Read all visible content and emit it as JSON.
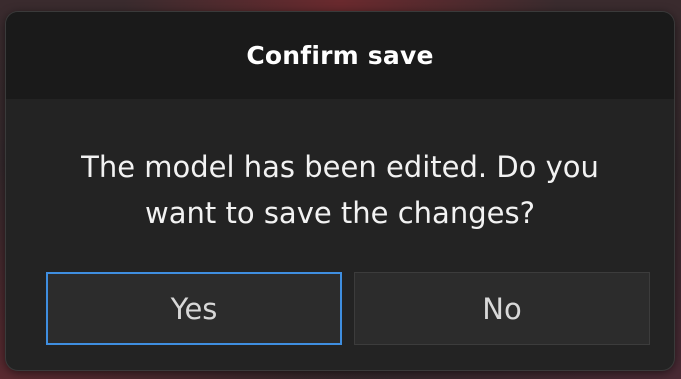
{
  "dialog": {
    "title": "Confirm save",
    "message_line1": "The model has been edited. Do you",
    "message_line2": "want to save the changes?",
    "buttons": {
      "yes_label": "Yes",
      "no_label": "No"
    }
  },
  "colors": {
    "focus_accent": "#3f8ee0",
    "dialog_bg": "#232323",
    "title_bg": "#1a1a1a"
  }
}
